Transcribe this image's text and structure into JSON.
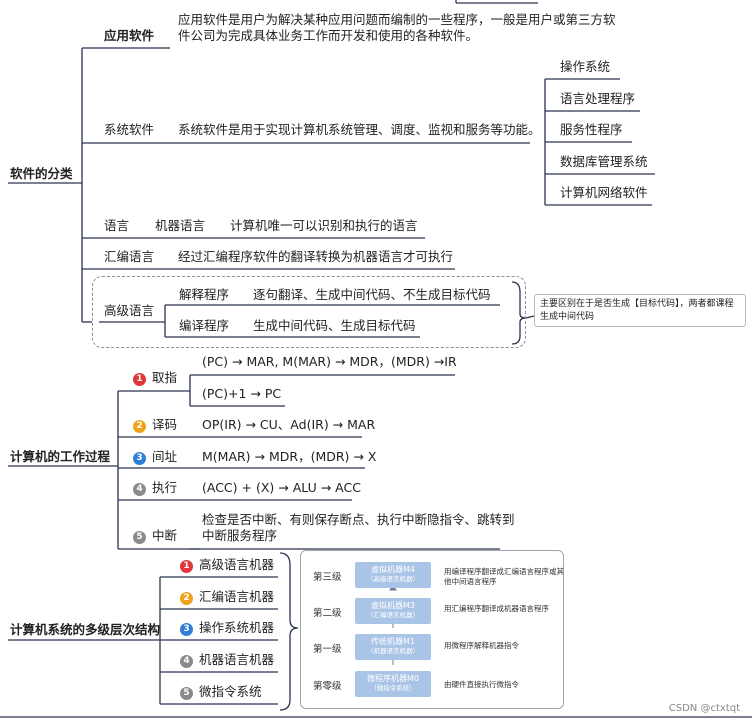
{
  "sec1": {
    "title": "软件的分类",
    "app": {
      "label": "应用软件",
      "desc1": "应用软件是用户为解决某种应用问题而编制的一些程序，一般是用户或第三方软",
      "desc2": "件公司为完成具体业务工作而开发和使用的各种软件。"
    },
    "sys": {
      "label": "系统软件",
      "desc": "系统软件是用于实现计算机系统管理、调度、监视和服务等功能。",
      "items": [
        "操作系统",
        "语言处理程序",
        "服务性程序",
        "数据库管理系统",
        "计算机网络软件"
      ]
    },
    "lang": {
      "label": "语言",
      "sub": "机器语言",
      "desc": "计算机唯一可以识别和执行的语言"
    },
    "asm": {
      "label": "汇编语言",
      "desc": "经过汇编程序软件的翻译转换为机器语言才可执行"
    },
    "high": {
      "label": "高级语言",
      "interp": {
        "label": "解释程序",
        "desc": "逐句翻译、生成中间代码、不生成目标代码"
      },
      "comp": {
        "label": "编译程序",
        "desc": "生成中间代码、生成目标代码"
      },
      "note": "主要区别在于是否生成【目标代码】，两者都课程生成中间代码"
    }
  },
  "sec2": {
    "title": "计算机的工作过程",
    "fetch": {
      "num": "1",
      "label": "取指",
      "step1": "(PC)  → MAR, M(MAR) → MDR，(MDR) →IR",
      "step2": "(PC)+1 → PC"
    },
    "decode": {
      "num": "2",
      "label": "译码",
      "desc": "OP(IR) → CU、Ad(IR) → MAR"
    },
    "access": {
      "num": "3",
      "label": "间址",
      "desc": "M(MAR) → MDR，(MDR) → X"
    },
    "exec": {
      "num": "4",
      "label": "执行",
      "desc": "(ACC) + (X) → ALU → ACC"
    },
    "intr": {
      "num": "5",
      "label": "中断",
      "desc1": "检查是否中断、有则保存断点、执行中断隐指令、跳转到",
      "desc2": "中断服务程序"
    }
  },
  "sec3": {
    "title": "计算机系统的多级层次结构",
    "items": [
      {
        "num": "1",
        "label": "高级语言机器"
      },
      {
        "num": "2",
        "label": "汇编语言机器"
      },
      {
        "num": "3",
        "label": "操作系统机器"
      },
      {
        "num": "4",
        "label": "机器语言机器"
      },
      {
        "num": "5",
        "label": "微指令系统"
      }
    ],
    "figure": {
      "levels": [
        {
          "level": "第三级",
          "machine": "虚拟机器M4",
          "sub": "（高级语言机器）",
          "desc1": "用编译程序翻译成汇编语言程序或其",
          "desc2": "他中间语言程序"
        },
        {
          "level": "第二级",
          "machine": "虚拟机器M3",
          "sub": "（汇编语言机器）",
          "desc1": "用汇编程序翻译成机器语言程序",
          "desc2": ""
        },
        {
          "level": "第一级",
          "machine": "传统机器M1",
          "sub": "（机器语言机器）",
          "desc1": "用微程序解释机器指令",
          "desc2": ""
        },
        {
          "level": "第零级",
          "machine": "微程序机器M0",
          "sub": "（微指令系统）",
          "desc1": "由硬件直接执行微指令",
          "desc2": ""
        }
      ]
    }
  },
  "watermark": "CSDN @ctxtqt"
}
